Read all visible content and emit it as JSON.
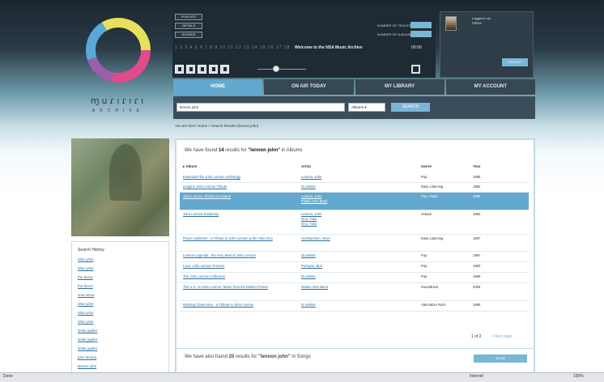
{
  "logo": {
    "text": "ɱuɾıɾıɾı",
    "subtitle": "ARCHIVE"
  },
  "header": {
    "nav_buttons": [
      "PLAYLIST",
      "DETAILS",
      "SOURCE"
    ],
    "stats": [
      {
        "label": "NUMBER OF TRACKS"
      },
      {
        "label": "NUMBER OF ALBUMS"
      }
    ],
    "ticker": "1 2 3 4 5 6 7 8 9 10 11 12 13 14 15 16 17 18 19 20 21",
    "welcome": "Welcome to the NSA Music Archive",
    "time": "00:00",
    "accent": "#63a8cf"
  },
  "user": {
    "logged_in_label": "Logged in as",
    "name": "FREIA",
    "logout_label": "LOGOUT"
  },
  "tabs": [
    {
      "label": "HOME",
      "active": true
    },
    {
      "label": "ON AIR TODAY",
      "active": false
    },
    {
      "label": "MY LIBRARY",
      "active": false
    },
    {
      "label": "MY ACCOUNT",
      "active": false
    }
  ],
  "search": {
    "value": "lennon john",
    "scope": "Albums",
    "button": "SEARCH"
  },
  "breadcrumb": "You are here: Home > Search Results (lennon john)",
  "history": {
    "title": "Search History",
    "items": [
      "elton john",
      "elton john",
      "the doors",
      "the doors",
      "soul stone",
      "elton john",
      "elton john",
      "elton john",
      "sister jupiter",
      "sister jupiter",
      "sister jupiter",
      "john lennon",
      "lennon john"
    ]
  },
  "results": {
    "prefix": "We have found",
    "count": "14",
    "middle": "results for",
    "query": "\"lennon john\"",
    "suffix": "in Albums",
    "columns": [
      "▸ Album",
      "Artist",
      "Genre",
      "Year"
    ],
    "rows": [
      {
        "album": "Essential Film John Lennon Anthology",
        "artist": [
          "Lennon, John"
        ],
        "genre": "Pop",
        "year": "1985",
        "highlight": false
      },
      {
        "album": "Imagine John Lennon Tribute",
        "artist": [
          "Di artister"
        ],
        "genre": "Easy Listening",
        "year": "1982",
        "highlight": false
      },
      {
        "album": "John Lennon: Plastic Ono Band",
        "artist": [
          "Lennon, John",
          "Plastic Ono Band"
        ],
        "genre": "Pop / Rock",
        "year": "2000",
        "highlight": true
      },
      {
        "album": "John Lennon Testimony",
        "artist": [
          "Lennon, John",
          "Ono, Yoko",
          "Ono, Yoko"
        ],
        "genre": "Vokaal",
        "year": "1993",
        "highlight": false
      },
      {
        "album": "Peace Hyllebrint - a Tribute to John Lennon & the Yoko Ono",
        "artist": [
          "Vocktwerken, Neve"
        ],
        "genre": "Easy Listening",
        "year": "1997",
        "highlight": false
      },
      {
        "album": "Lennon Legends - the Very Best of John Lennon",
        "artist": [
          "Di artister"
        ],
        "genre": "Pop",
        "year": "1997",
        "highlight": false
      },
      {
        "album": "Love: John Lennon Forever",
        "artist": [
          "Pensyon, Bon"
        ],
        "genre": "Pop",
        "year": "1983",
        "highlight": false
      },
      {
        "album": "The John Lennon Collection",
        "artist": [
          "Di artister"
        ],
        "genre": "Pop",
        "year": "1989",
        "highlight": false
      },
      {
        "album": "The U.S. vs John Lennon: Music from the Motion Picture",
        "artist": [
          "Malmo Nico Bano"
        ],
        "genre": "Soundtrack",
        "year": "2006",
        "highlight": false
      },
      {
        "album": "Working Class Hero - a Tribute to John Lennon",
        "artist": [
          "Di artister"
        ],
        "genre": "Alternative Rock",
        "year": "1995",
        "highlight": false
      }
    ],
    "pager": "1 of 2",
    "next": "» Next page"
  },
  "songs": {
    "prefix": "We have also found",
    "count": "25",
    "middle": "results for",
    "query": "\"lennon john\"",
    "suffix": "in Songs",
    "button": "SHOW"
  },
  "statusbar": {
    "left": "Done",
    "zone": "Internet",
    "zoom": "100%"
  }
}
